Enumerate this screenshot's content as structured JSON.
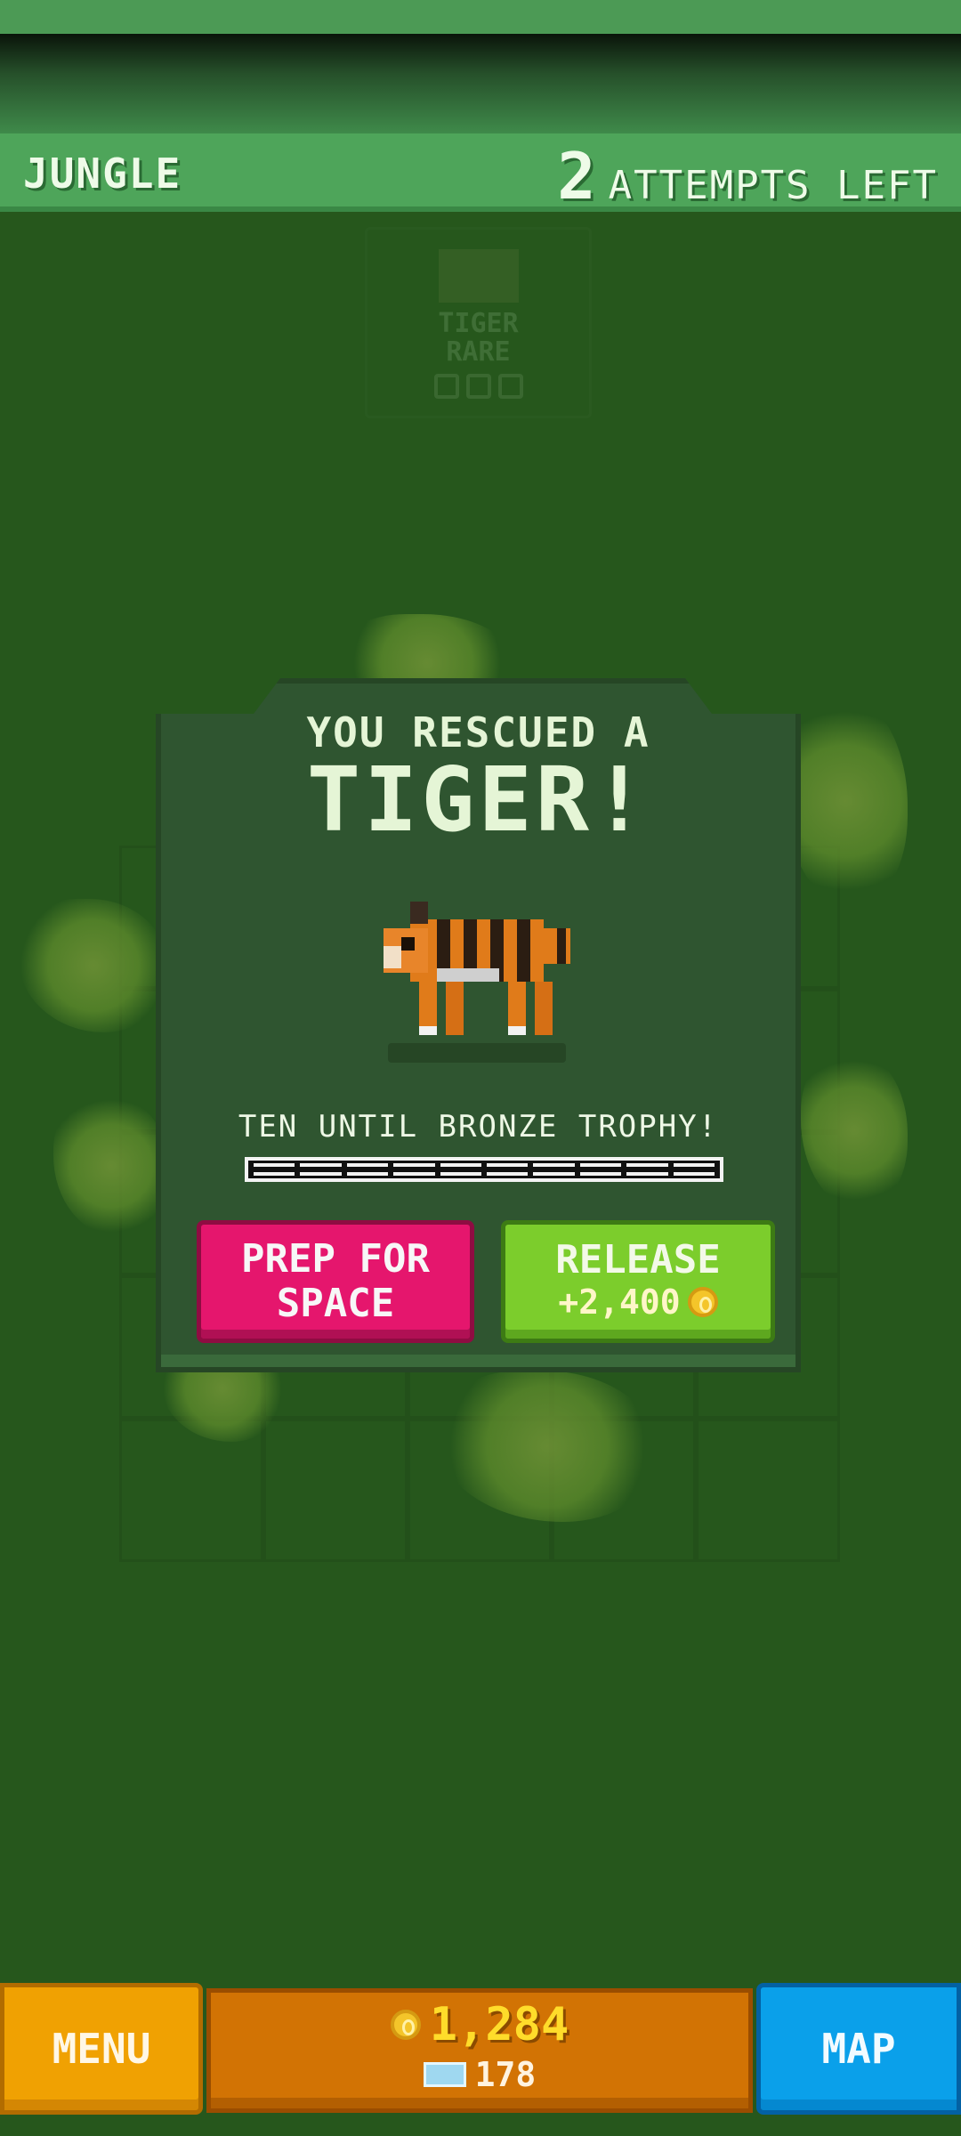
{
  "header": {
    "zone_name": "JUNGLE",
    "attempts_count": "2",
    "attempts_label": "ATTEMPTS LEFT"
  },
  "background_card": {
    "animal": "TIGER",
    "rarity": "RARE"
  },
  "modal": {
    "headline": "YOU RESCUED A",
    "animal_name": "TIGER!",
    "trophy_progress_text": "TEN UNTIL BRONZE TROPHY!",
    "progress_segments": 10,
    "progress_filled": 0,
    "prep_button_label": "PREP FOR SPACE",
    "release_button_label": "RELEASE",
    "release_reward": "+2,400"
  },
  "bottom_bar": {
    "menu_label": "MENU",
    "coins": "1,284",
    "gems": "178",
    "map_label": "MAP"
  },
  "colors": {
    "background": "#26571c",
    "header": "#4ea55a",
    "prep_button": "#e5166d",
    "release_button": "#7ccd2c",
    "menu_button": "#f0a102",
    "map_button": "#0aa0ea",
    "wallet": "#d27304"
  },
  "icons": {
    "coin": "coin-icon",
    "gem": "gem-icon",
    "animal": "tiger-sprite"
  }
}
